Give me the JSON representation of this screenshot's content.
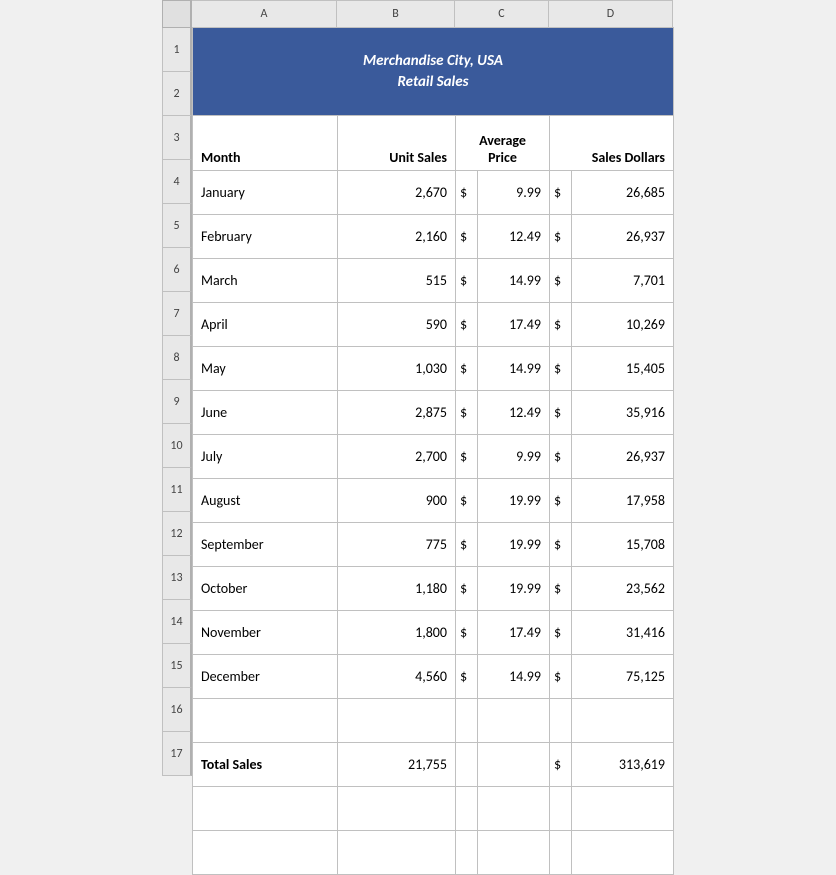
{
  "title": {
    "line1": "Merchandise City, USA",
    "line2": "Retail Sales"
  },
  "columns": {
    "letters": [
      "A",
      "B",
      "C",
      "D"
    ],
    "widths": [
      145,
      118,
      94,
      124
    ]
  },
  "row_numbers": [
    "1",
    "2",
    "3",
    "4",
    "5",
    "6",
    "7",
    "8",
    "9",
    "10",
    "11",
    "12",
    "13",
    "14",
    "15",
    "16",
    "17"
  ],
  "headers": {
    "month": "Month",
    "unit_sales": "Unit Sales",
    "avg_price_line1": "Average",
    "avg_price_line2": "Price",
    "sales_dollars": "Sales Dollars"
  },
  "rows": [
    {
      "month": "January",
      "units": "2,670",
      "price": "9.99",
      "dollars": "26,685"
    },
    {
      "month": "February",
      "units": "2,160",
      "price": "12.49",
      "dollars": "26,937"
    },
    {
      "month": "March",
      "units": "515",
      "price": "14.99",
      "dollars": "7,701"
    },
    {
      "month": "April",
      "units": "590",
      "price": "17.49",
      "dollars": "10,269"
    },
    {
      "month": "May",
      "units": "1,030",
      "price": "14.99",
      "dollars": "15,405"
    },
    {
      "month": "June",
      "units": "2,875",
      "price": "12.49",
      "dollars": "35,916"
    },
    {
      "month": "July",
      "units": "2,700",
      "price": "9.99",
      "dollars": "26,937"
    },
    {
      "month": "August",
      "units": "900",
      "price": "19.99",
      "dollars": "17,958"
    },
    {
      "month": "September",
      "units": "775",
      "price": "19.99",
      "dollars": "15,708"
    },
    {
      "month": "October",
      "units": "1,180",
      "price": "19.99",
      "dollars": "23,562"
    },
    {
      "month": "November",
      "units": "1,800",
      "price": "17.49",
      "dollars": "31,416"
    },
    {
      "month": "December",
      "units": "4,560",
      "price": "14.99",
      "dollars": "75,125"
    }
  ],
  "totals": {
    "label": "Total Sales",
    "units": "21,755",
    "dollars": "313,619"
  },
  "colors": {
    "header_bg": "#3a5a9b",
    "header_text": "#ffffff",
    "grid_line": "#c0c0c0"
  }
}
